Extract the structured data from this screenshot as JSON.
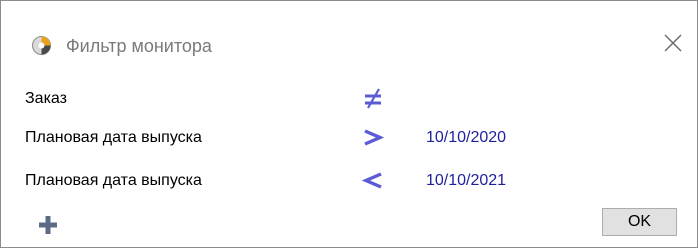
{
  "window": {
    "title": "Фильтр монитора",
    "icon": "monitor-filter-icon",
    "close_icon": "close-icon"
  },
  "conditions": [
    {
      "label": "Заказ",
      "operator": "not-equal",
      "operator_icon": "not-equal-icon",
      "value": ""
    },
    {
      "label": "Плановая дата выпуска",
      "operator": "greater-than",
      "operator_icon": "greater-than-icon",
      "value": "10/10/2020"
    },
    {
      "label": "Плановая дата выпуска",
      "operator": "less-than",
      "operator_icon": "less-than-icon",
      "value": "10/10/2021"
    }
  ],
  "footer": {
    "add_icon": "plus-icon",
    "ok_label": "OK"
  },
  "colors": {
    "operator": "#5b5bd6",
    "value_text": "#1f1f9c",
    "title_text": "#7a7a7a",
    "add_icon": "#5b6b86"
  }
}
